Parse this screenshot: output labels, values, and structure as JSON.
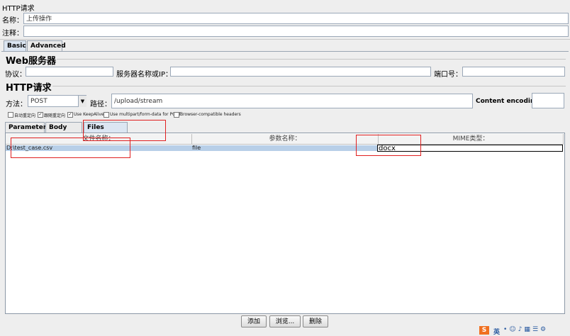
{
  "header": {
    "title": "HTTP请求",
    "name_label": "名称：",
    "name_value": "上传操作",
    "comment_label": "注释：",
    "comment_value": ""
  },
  "tabs_top": [
    {
      "label": "Basic"
    },
    {
      "label": "Advanced"
    }
  ],
  "web_server": {
    "heading": "Web服务器",
    "protocol_label": "协议：",
    "protocol_value": "",
    "server_label": "服务器名称或IP：",
    "server_value": "",
    "port_label": "端口号：",
    "port_value": ""
  },
  "http_request": {
    "heading": "HTTP请求",
    "method_label": "方法：",
    "method_value": "POST",
    "path_label": "路径：",
    "path_value": "/upload/stream",
    "encoding_label": "Content encoding:",
    "encoding_value": ""
  },
  "options": [
    {
      "label": "自动重定向",
      "checked": false
    },
    {
      "label": "跟随重定向",
      "checked": true
    },
    {
      "label": "Use KeepAlive",
      "checked": true
    },
    {
      "label": "Use multipart/form-data for POST",
      "checked": false
    },
    {
      "label": "Browser-compatible headers",
      "checked": false
    }
  ],
  "tabs_inner": [
    {
      "label": "Parameters"
    },
    {
      "label": "Body Data"
    },
    {
      "label": "Files Upload"
    }
  ],
  "files_table": {
    "headers": [
      "文件名称：",
      "参数名称：",
      "MIME类型："
    ],
    "rows": [
      {
        "file": "D:\\test_case.csv",
        "param": "file",
        "mime": "docx"
      }
    ]
  },
  "buttons": {
    "add": "添加",
    "browse": "浏览...",
    "delete": "删除"
  },
  "watermark": {
    "brand": "S",
    "text": "英"
  }
}
